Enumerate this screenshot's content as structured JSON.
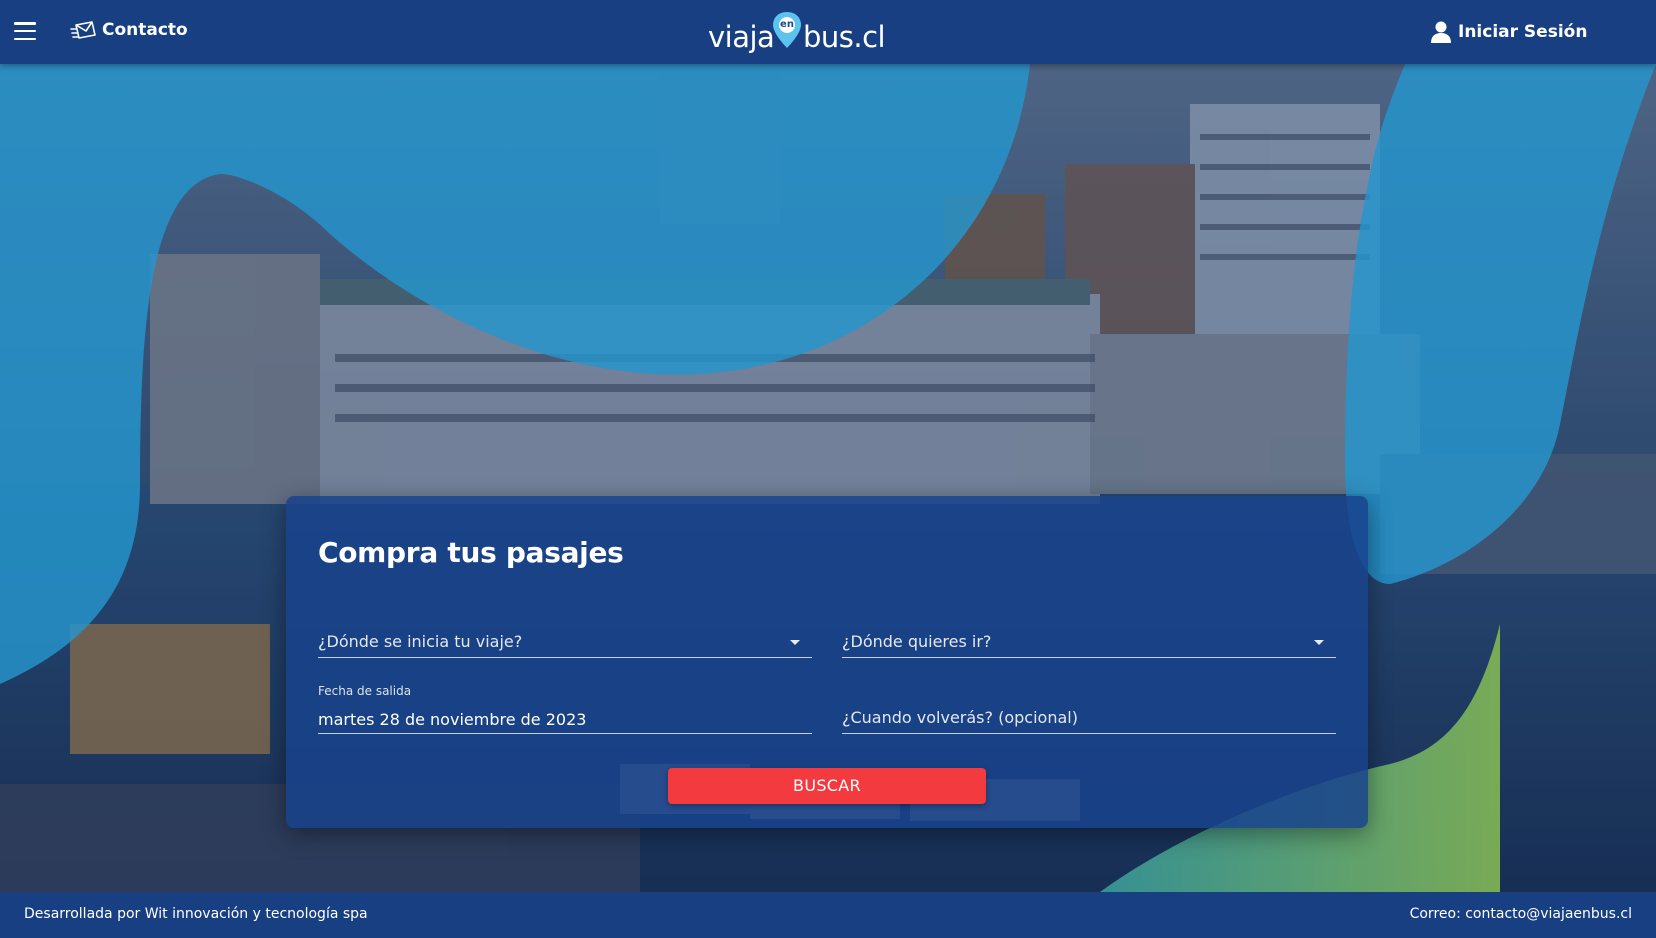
{
  "header": {
    "contact_label": "Contacto",
    "logo": {
      "part1": "viaja",
      "pin_text": "en",
      "part2": "bus.cl"
    },
    "login_label": "Iniciar Sesión"
  },
  "form": {
    "title": "Compra tus pasajes",
    "origin_placeholder": "¿Dónde se inicia tu viaje?",
    "destination_placeholder": "¿Dónde quieres ir?",
    "departure_label": "Fecha de salida",
    "departure_value": "martes 28 de noviembre de 2023",
    "return_placeholder": "¿Cuando volverás? (opcional)",
    "search_button": "BUSCAR"
  },
  "footer": {
    "developer": "Desarrollada por Wit innovación y tecnología spa",
    "email": "Correo: contacto@viajaenbus.cl"
  },
  "icons": {
    "menu": "hamburger-icon",
    "contact": "envelope-icon",
    "logo_pin": "location-pin-icon",
    "user": "user-icon",
    "dropdown": "caret-down-icon"
  },
  "colors": {
    "header_bg": "#173f82",
    "card_bg": "#18428c",
    "button_bg": "#f23a3f",
    "wave_light": "#29a8e0",
    "wave_green": "#8fc653"
  }
}
